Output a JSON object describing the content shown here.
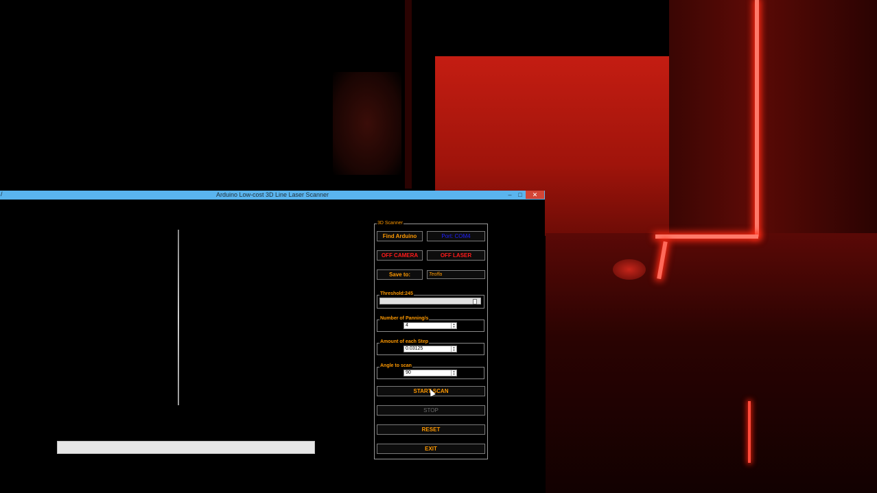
{
  "window": {
    "title": "Arduino Low-cost 3D Line Laser Scanner",
    "left_glyph": "/",
    "min_glyph": "–",
    "max_glyph": "□",
    "close_glyph": "✕"
  },
  "progress": {
    "fraction": 0.0
  },
  "panel": {
    "legend": "3D Scanner",
    "find_arduino": "Find Arduino",
    "port_status": "Port: COM4",
    "off_camera": "OFF CAMERA",
    "off_laser": "OFF LASER",
    "save_to": "Save to:",
    "save_path": "Teoffa",
    "threshold": {
      "label": "Threshold:245",
      "value": 245,
      "max": 255
    },
    "panning": {
      "label": "Number of Panning/s",
      "value": "4"
    },
    "step": {
      "label": "Amount of each Step",
      "value": "0.03125"
    },
    "angle": {
      "label": "Angle to scan",
      "value": "90"
    },
    "start_scan": "START SCAN",
    "stop": "STOP",
    "reset": "RESET",
    "exit": "EXIT"
  },
  "colors": {
    "accent": "#ff9900",
    "warning": "#ff1a1a",
    "port": "#2020ff",
    "titlebar": "#5ab4ee"
  },
  "icons": {
    "close": "close-icon",
    "minimize": "minimize-icon",
    "maximize": "maximize-icon",
    "spin": "spin-arrows-icon"
  }
}
